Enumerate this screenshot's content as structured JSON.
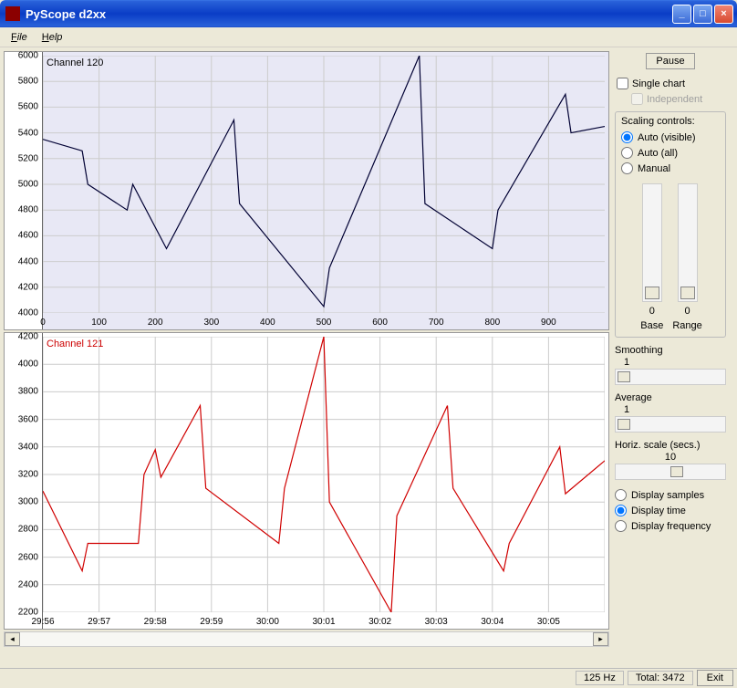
{
  "window": {
    "title": "PyScope d2xx"
  },
  "menu": {
    "file": "File",
    "help": "Help"
  },
  "side": {
    "pause": "Pause",
    "single_chart": "Single chart",
    "independent": "Independent",
    "scaling_title": "Scaling controls:",
    "scaling": {
      "auto_visible": "Auto (visible)",
      "auto_all": "Auto (all)",
      "manual": "Manual"
    },
    "base_val": "0",
    "range_val": "0",
    "base_lbl": "Base",
    "range_lbl": "Range",
    "smoothing_lbl": "Smoothing",
    "smoothing_val": "1",
    "average_lbl": "Average",
    "average_val": "1",
    "hscale_lbl": "Horiz. scale (secs.)",
    "hscale_val": "10",
    "disp_samples": "Display samples",
    "disp_time": "Display time",
    "disp_freq": "Display frequency"
  },
  "status": {
    "hz": "125 Hz",
    "total": "Total: 3472",
    "exit": "Exit"
  },
  "chart_data": [
    {
      "type": "line",
      "title": "Channel 120",
      "color": "#000033",
      "ylim": [
        4000,
        6000
      ],
      "xlim": [
        0,
        1000
      ],
      "xticks": [
        0,
        100,
        200,
        300,
        400,
        500,
        600,
        700,
        800,
        900
      ],
      "yticks": [
        4000,
        4200,
        4400,
        4600,
        4800,
        5000,
        5200,
        5400,
        5600,
        5800,
        6000
      ],
      "x": [
        0,
        70,
        80,
        150,
        160,
        220,
        340,
        350,
        500,
        510,
        670,
        680,
        800,
        810,
        930,
        940,
        1000
      ],
      "values": [
        5350,
        5260,
        5000,
        4800,
        5000,
        4500,
        5500,
        4850,
        4050,
        4350,
        6000,
        4850,
        4500,
        4800,
        5700,
        5400,
        5450
      ]
    },
    {
      "type": "line",
      "title": "Channel 121",
      "color": "#d00000",
      "ylim": [
        2200,
        4200
      ],
      "yticks": [
        2200,
        2400,
        2600,
        2800,
        3000,
        3200,
        3400,
        3600,
        3800,
        4000,
        4200
      ],
      "xticks_labels": [
        "29:56",
        "29:57",
        "29:58",
        "29:59",
        "30:00",
        "30:01",
        "30:02",
        "30:03",
        "30:04",
        "30:05"
      ],
      "x_units": [
        0,
        1,
        2,
        3,
        4,
        5,
        6,
        7,
        8,
        9,
        10
      ],
      "x": [
        0,
        0.7,
        0.8,
        1.7,
        1.8,
        2.0,
        2.1,
        2.8,
        2.9,
        4.2,
        4.3,
        5.0,
        5.1,
        6.2,
        6.3,
        7.2,
        7.3,
        8.2,
        8.3,
        9.2,
        9.3,
        10.0
      ],
      "values": [
        3080,
        2500,
        2700,
        2700,
        3200,
        3380,
        3180,
        3700,
        3100,
        2700,
        3100,
        4200,
        3000,
        2200,
        2900,
        3700,
        3100,
        2500,
        2700,
        3400,
        3060,
        3300
      ]
    }
  ]
}
